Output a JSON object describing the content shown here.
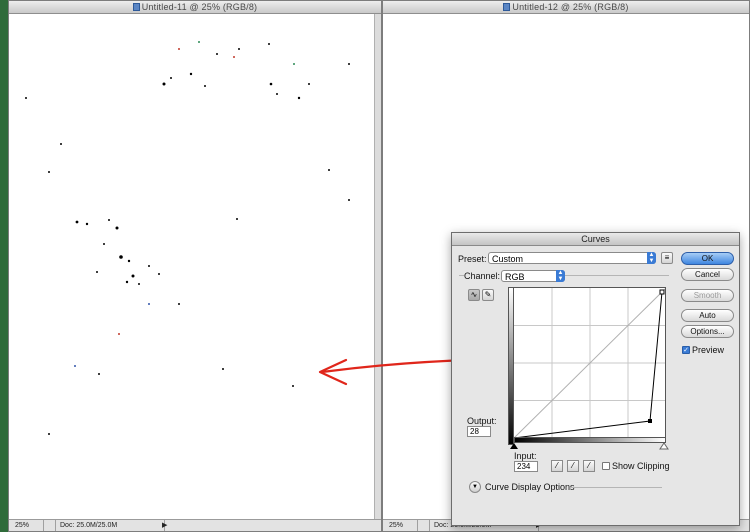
{
  "left_window": {
    "title": "Untitled-11 @ 25% (RGB/8)",
    "status_zoom": "25%",
    "status_doc": "Doc: 25.0M/25.0M"
  },
  "right_window": {
    "title": "Untitled-12 @ 25% (RGB/8)",
    "status_zoom": "25%",
    "status_doc": "Doc: 25.0M/25.0M"
  },
  "curves": {
    "title": "Curves",
    "preset_label": "Preset:",
    "preset_value": "Custom",
    "channel_label": "Channel:",
    "channel_value": "RGB",
    "output_label": "Output:",
    "output_value": "28",
    "input_label": "Input:",
    "input_value": "234",
    "show_clipping_label": "Show Clipping",
    "display_options_label": "Curve Display Options",
    "buttons": {
      "ok": "OK",
      "cancel": "Cancel",
      "smooth": "Smooth",
      "auto": "Auto",
      "options": "Options..."
    },
    "preview_label": "Preview",
    "preview_checked": true,
    "show_clipping_checked": false
  },
  "colors": {
    "annotation_arrow": "#e0261b",
    "accent": "#3a7bd5",
    "desktop": "#2f6b3a"
  },
  "icons": {
    "preset_menu": "preset-options-icon",
    "curve_tool": "curve-point-tool-icon",
    "pencil_tool": "pencil-tool-icon",
    "black_eyedropper": "black-eyedropper-icon",
    "gray_eyedropper": "gray-eyedropper-icon",
    "white_eyedropper": "white-eyedropper-icon",
    "disclosure": "disclosure-triangle-icon"
  }
}
